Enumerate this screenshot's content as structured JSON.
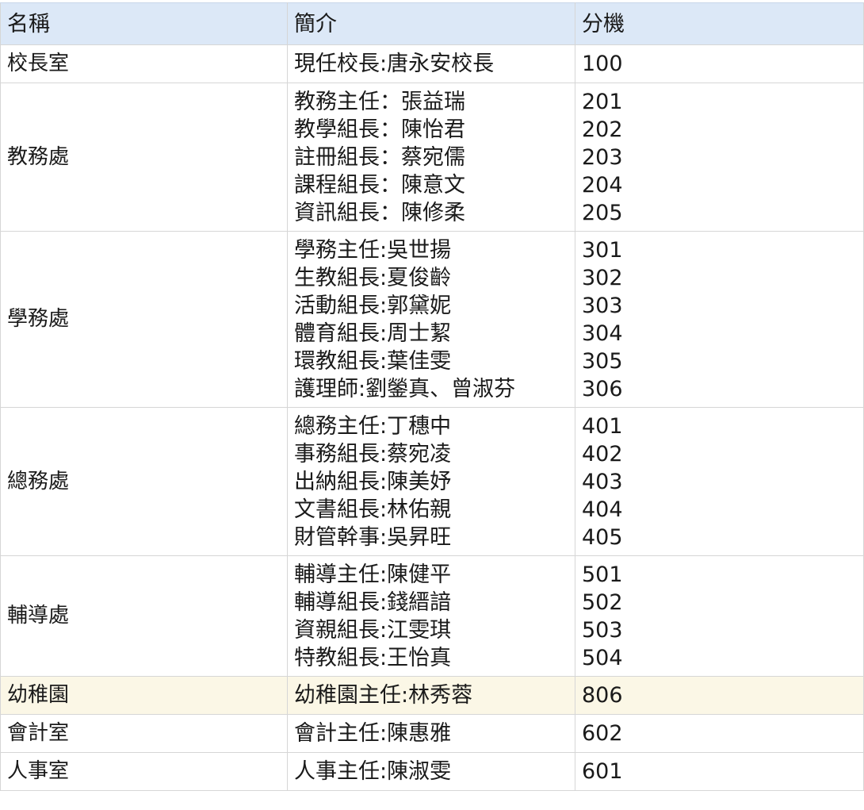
{
  "headers": [
    "名稱",
    "簡介",
    "分機"
  ],
  "rows": [
    {
      "name": "校長室",
      "entries": [
        "現任校長:唐永安校長"
      ],
      "extensions": [
        "100"
      ]
    },
    {
      "name": "教務處",
      "entries": [
        "教務主任：張益瑞",
        "教學組長：陳怡君",
        "註冊組長：蔡宛儒",
        "課程組長：陳意文",
        "資訊組長：陳修柔"
      ],
      "extensions": [
        "201",
        "202",
        "203",
        "204",
        "205"
      ]
    },
    {
      "name": "學務處",
      "entries": [
        "學務主任:吳世揚",
        "生教組長:夏俊齡",
        "活動組長:郭黛妮",
        "體育組長:周士絜",
        "環教組長:葉佳雯",
        "護理師:劉鎣真、曾淑芬"
      ],
      "extensions": [
        "301",
        "302",
        "303",
        "304",
        "305",
        "306"
      ]
    },
    {
      "name": "總務處",
      "entries": [
        "總務主任:丁穗中",
        "事務組長:蔡宛凌",
        "出納組長:陳美妤",
        "文書組長:林佑親",
        "財管幹事:吳昇旺"
      ],
      "extensions": [
        "401",
        "402",
        "403",
        "404",
        "405"
      ]
    },
    {
      "name": "輔導處",
      "entries": [
        "輔導主任:陳健平",
        "輔導組長:錢縉諳",
        "資親組長:江雯琪",
        "特教組長:王怡真"
      ],
      "extensions": [
        "501",
        "502",
        "503",
        "504"
      ]
    },
    {
      "name": "幼稚園",
      "entries": [
        "幼稚園主任:林秀蓉"
      ],
      "extensions": [
        "806"
      ],
      "highlight": true
    },
    {
      "name": "會計室",
      "entries": [
        "會計主任:陳惠雅"
      ],
      "extensions": [
        "602"
      ]
    },
    {
      "name": "人事室",
      "entries": [
        "人事主任:陳淑雯"
      ],
      "extensions": [
        "601"
      ]
    }
  ],
  "colors": {
    "header_bg": "#dce8f7",
    "highlight_bg": "#fbf7e6",
    "border": "#d6d6d6"
  }
}
